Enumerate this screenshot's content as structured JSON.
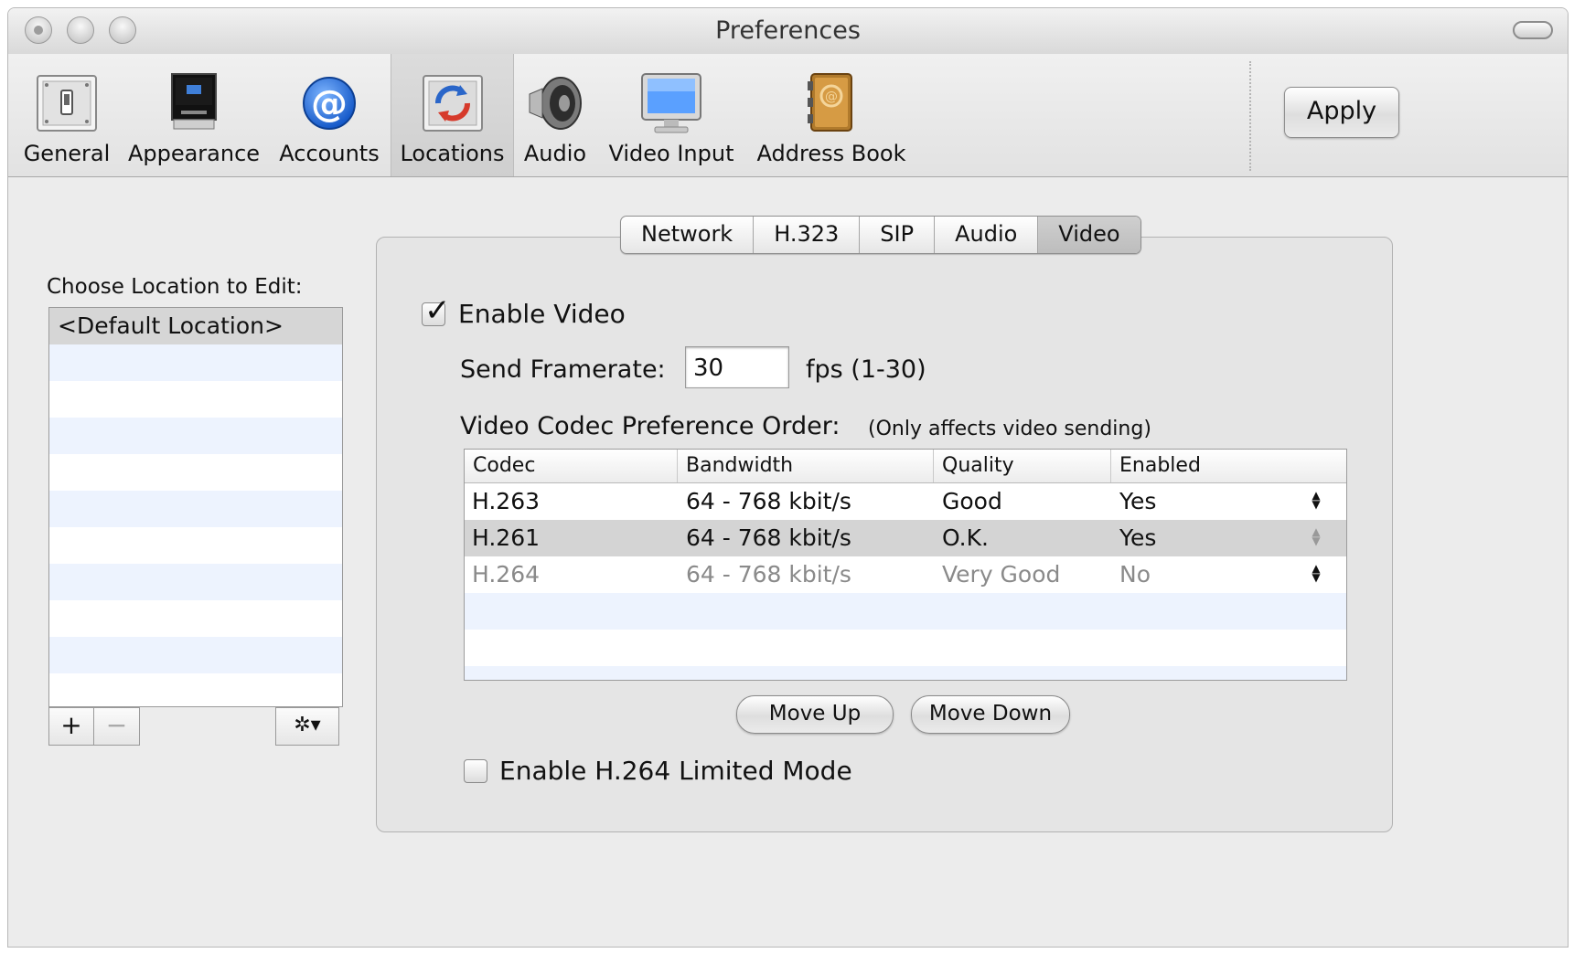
{
  "window": {
    "title": "Preferences"
  },
  "toolbar": {
    "items": [
      {
        "label": "General",
        "icon": "switch-icon"
      },
      {
        "label": "Appearance",
        "icon": "monitor-icon"
      },
      {
        "label": "Accounts",
        "icon": "at-sign-icon"
      },
      {
        "label": "Locations",
        "icon": "locations-icon",
        "selected": true
      },
      {
        "label": "Audio",
        "icon": "speaker-icon"
      },
      {
        "label": "Video Input",
        "icon": "display-icon"
      },
      {
        "label": "Address Book",
        "icon": "address-book-icon"
      }
    ],
    "apply_label": "Apply"
  },
  "locations": {
    "label": "Choose Location to Edit:",
    "items": [
      "<Default Location>"
    ],
    "add_label": "+",
    "remove_label": "−",
    "action_label": "✲▾"
  },
  "tabs": {
    "items": [
      "Network",
      "H.323",
      "SIP",
      "Audio",
      "Video"
    ],
    "active": "Video"
  },
  "video": {
    "enable_video_label": "Enable Video",
    "enable_video_checked": true,
    "framerate_label": "Send Framerate:",
    "framerate_value": "30",
    "framerate_unit": "fps (1-30)",
    "codec_order_label": "Video Codec Preference Order:",
    "codec_order_note": "(Only affects video sending)",
    "table": {
      "headers": [
        "Codec",
        "Bandwidth",
        "Quality",
        "Enabled"
      ],
      "rows": [
        {
          "codec": "H.263",
          "bandwidth": "64 - 768 kbit/s",
          "quality": "Good",
          "enabled": "Yes"
        },
        {
          "codec": "H.261",
          "bandwidth": "64 - 768 kbit/s",
          "quality": "O.K.",
          "enabled": "Yes"
        },
        {
          "codec": "H.264",
          "bandwidth": "64 - 768 kbit/s",
          "quality": "Very Good",
          "enabled": "No"
        }
      ]
    },
    "move_up_label": "Move Up",
    "move_down_label": "Move Down",
    "limited_mode_label": "Enable H.264 Limited Mode",
    "limited_mode_checked": false
  },
  "colors": {
    "selection_gray": "#d4d4d4",
    "stripe_blue": "#edf3fe",
    "at_icon_blue": "#1e6fe0"
  }
}
